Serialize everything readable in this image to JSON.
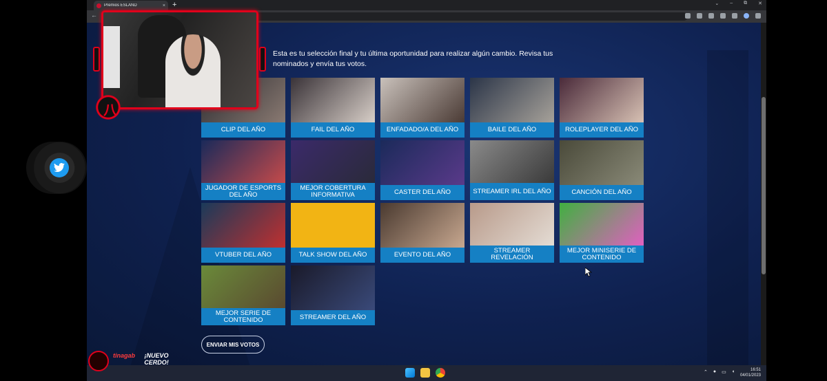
{
  "browser": {
    "tab_title": "Premios ESLAND",
    "tab_close": "×",
    "new_tab": "+",
    "back": "←",
    "window_controls": [
      "⌄",
      "–",
      "⧉",
      "✕"
    ]
  },
  "page": {
    "intro": "Esta es tu selección final y tu última oportunidad para realizar algún cambio. Revisa tus nominados y envía tus votos.",
    "submit_label": "ENVIAR MIS VOTOS"
  },
  "categories": [
    {
      "label": "CLIP DEL AÑO",
      "colors": [
        "#2b2b30",
        "#8a7a72"
      ]
    },
    {
      "label": "FAIL DEL AÑO",
      "colors": [
        "#3a3338",
        "#d8cfc8"
      ]
    },
    {
      "label": "ENFADADO/A DEL AÑO",
      "colors": [
        "#c9c1bb",
        "#4a3a34"
      ]
    },
    {
      "label": "BAILE DEL AÑO",
      "colors": [
        "#2b3548",
        "#a7a29a"
      ]
    },
    {
      "label": "ROLEPLAYER DEL AÑO",
      "colors": [
        "#4a2a3a",
        "#d8c2b4"
      ]
    },
    {
      "label": "JUGADOR DE ESPORTS DEL AÑO",
      "colors": [
        "#1a2a5a",
        "#c44a4a"
      ]
    },
    {
      "label": "MEJOR COBERTURA INFORMATIVA",
      "colors": [
        "#3b2a6a",
        "#2a2a3a"
      ]
    },
    {
      "label": "CASTER DEL AÑO",
      "colors": [
        "#1b2a5a",
        "#5a3a8a"
      ]
    },
    {
      "label": "STREAMER IRL DEL AÑO",
      "colors": [
        "#8a8a8a",
        "#3a3a3a"
      ]
    },
    {
      "label": "CANCIÓN DEL AÑO",
      "colors": [
        "#4a4a3a",
        "#8a8a78"
      ]
    },
    {
      "label": "VTUBER DEL AÑO",
      "colors": [
        "#1a3a5a",
        "#c03030"
      ]
    },
    {
      "label": "TALK SHOW DEL AÑO",
      "colors": [
        "#f2b414",
        "#f2b414"
      ]
    },
    {
      "label": "EVENTO DEL AÑO",
      "colors": [
        "#4a3a30",
        "#c8a890"
      ]
    },
    {
      "label": "STREAMER REVELACIÓN",
      "colors": [
        "#b89a8a",
        "#e4dcd4"
      ]
    },
    {
      "label": "MEJOR MINISERIE DE CONTENIDO",
      "colors": [
        "#40b040",
        "#e060c0"
      ]
    },
    {
      "label": "MEJOR SERIE DE CONTENIDO",
      "colors": [
        "#6a8a3a",
        "#5a4a30"
      ]
    },
    {
      "label": "STREAMER DEL AÑO",
      "colors": [
        "#1a1a2a",
        "#3a4a7a"
      ]
    }
  ],
  "taskbar": {
    "time": "16:51",
    "date": "04/01/2023"
  },
  "overlay": {
    "cam_logo": "八",
    "alert_user": "tinagab",
    "alert_message": "¡NUEVO CERDO!"
  },
  "accent": "#1580c4",
  "stream_accent": "#e0001b",
  "icons": {
    "twitter": "twitter-icon",
    "cursor": "mouse-cursor-icon"
  }
}
